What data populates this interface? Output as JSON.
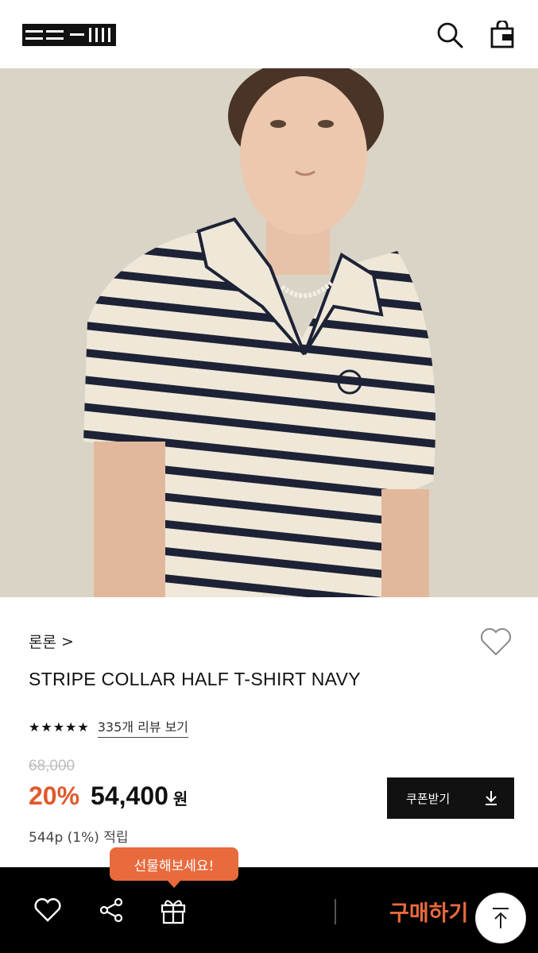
{
  "header": {
    "logo_text": "ROMROM",
    "search_icon": "search-icon",
    "cart_icon": "shopping-bag-icon"
  },
  "product": {
    "brand": "론론",
    "brand_chevron": ">",
    "title": "STRIPE COLLAR HALF T-SHIRT NAVY",
    "rating_stars": "★★★★★",
    "rating_value": 5,
    "review_link": "335개 리뷰 보기",
    "original_price": "68,000",
    "discount": "20%",
    "price": "54,400",
    "currency": "원",
    "points": "544p (1%) 적립",
    "coupon_label": "쿠폰받기"
  },
  "bottom_bar": {
    "gift_tooltip": "선물해보세요!",
    "buy_label": "구매하기"
  },
  "colors": {
    "accent": "#e96a3d",
    "discount": "#e05a2c",
    "dark": "#000000"
  }
}
